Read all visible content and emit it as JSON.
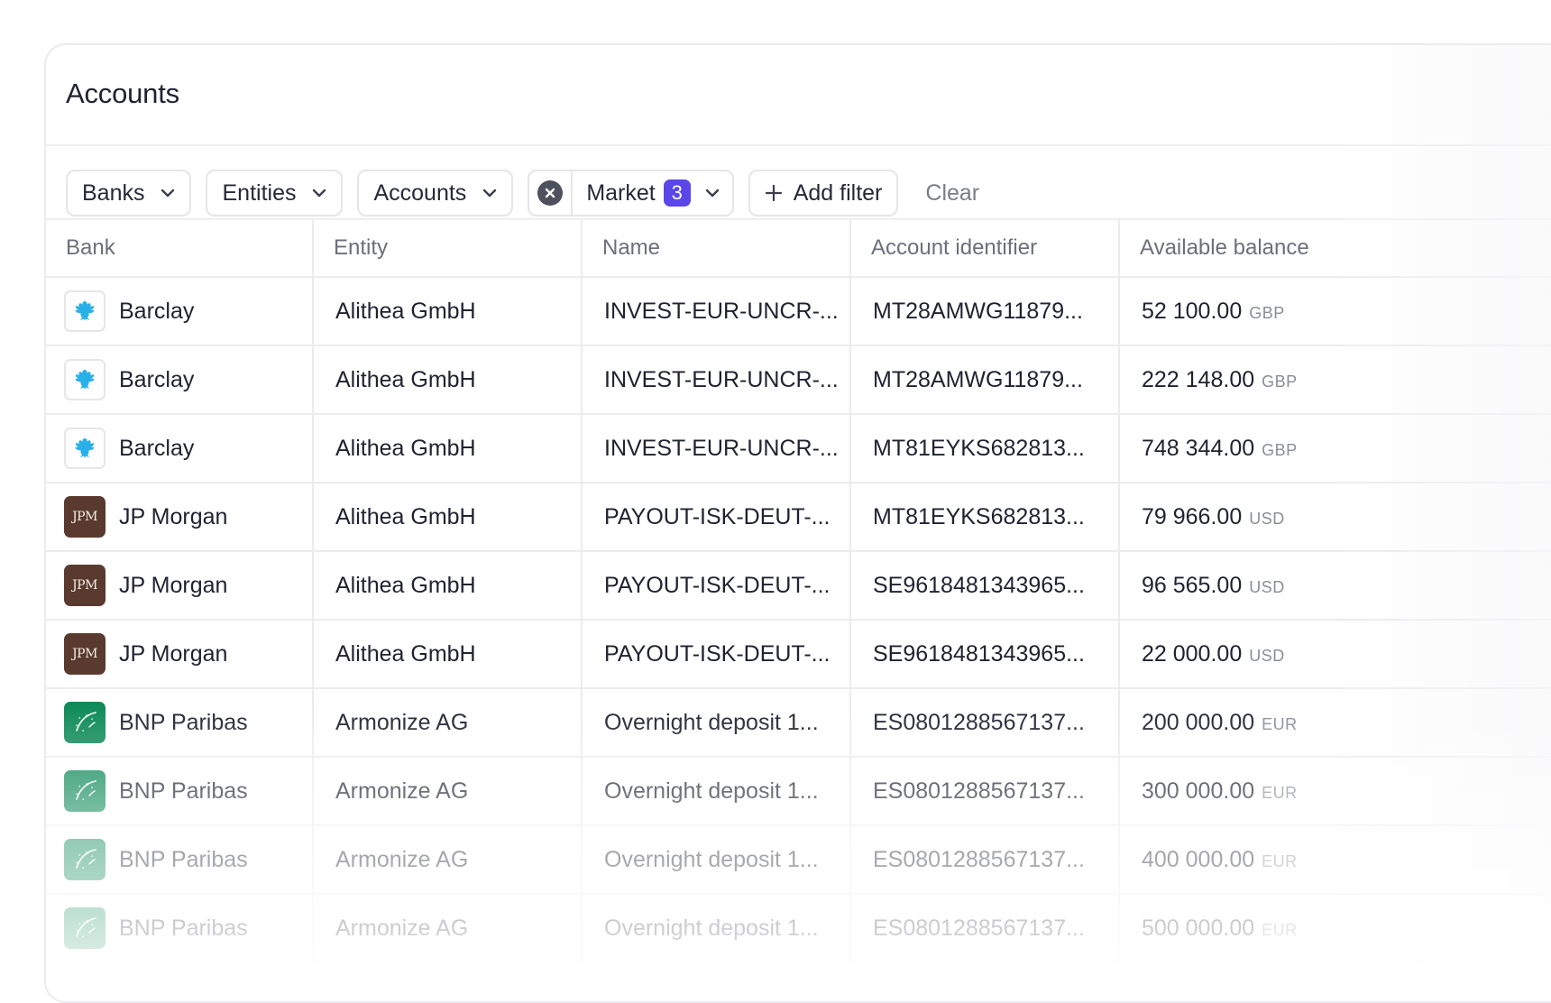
{
  "page": {
    "title": "Accounts"
  },
  "filters": {
    "banks_label": "Banks",
    "entities_label": "Entities",
    "accounts_label": "Accounts",
    "market_label": "Market",
    "market_count": "3",
    "add_filter_label": "Add filter",
    "clear_label": "Clear"
  },
  "table": {
    "columns": [
      "Bank",
      "Entity",
      "Name",
      "Account identifier",
      "Available balance"
    ],
    "rows": [
      {
        "bank": "Barclay",
        "logo": "barclay-eagle-icon",
        "entity": "Alithea GmbH",
        "name": "INVEST-EUR-UNCR-...",
        "account_id": "MT28AMWG11879...",
        "amount": "52 100.00",
        "currency": "GBP"
      },
      {
        "bank": "Barclay",
        "logo": "barclay-eagle-icon",
        "entity": "Alithea GmbH",
        "name": "INVEST-EUR-UNCR-...",
        "account_id": "MT28AMWG11879...",
        "amount": "222 148.00",
        "currency": "GBP"
      },
      {
        "bank": "Barclay",
        "logo": "barclay-eagle-icon",
        "entity": "Alithea GmbH",
        "name": "INVEST-EUR-UNCR-...",
        "account_id": "MT81EYKS682813...",
        "amount": "748 344.00",
        "currency": "GBP"
      },
      {
        "bank": "JP Morgan",
        "logo": "jpm-logo-icon",
        "logo_text": "JPM",
        "entity": "Alithea GmbH",
        "name": "PAYOUT-ISK-DEUT-...",
        "account_id": "MT81EYKS682813...",
        "amount": "79 966.00",
        "currency": "USD"
      },
      {
        "bank": "JP Morgan",
        "logo": "jpm-logo-icon",
        "logo_text": "JPM",
        "entity": "Alithea GmbH",
        "name": "PAYOUT-ISK-DEUT-...",
        "account_id": "SE9618481343965...",
        "amount": "96 565.00",
        "currency": "USD"
      },
      {
        "bank": "JP Morgan",
        "logo": "jpm-logo-icon",
        "logo_text": "JPM",
        "entity": "Alithea GmbH",
        "name": "PAYOUT-ISK-DEUT-...",
        "account_id": "SE9618481343965...",
        "amount": "22 000.00",
        "currency": "USD"
      },
      {
        "bank": "BNP Paribas",
        "logo": "bnp-stars-icon",
        "entity": "Armonize AG",
        "name": "Overnight deposit 1...",
        "account_id": "ES0801288567137...",
        "amount": "200 000.00",
        "currency": "EUR"
      },
      {
        "bank": "BNP Paribas",
        "logo": "bnp-stars-icon",
        "entity": "Armonize AG",
        "name": "Overnight deposit 1...",
        "account_id": "ES0801288567137...",
        "amount": "300 000.00",
        "currency": "EUR"
      },
      {
        "bank": "BNP Paribas",
        "logo": "bnp-stars-icon",
        "entity": "Armonize AG",
        "name": "Overnight deposit 1...",
        "account_id": "ES0801288567137...",
        "amount": "400 000.00",
        "currency": "EUR"
      },
      {
        "bank": "BNP Paribas",
        "logo": "bnp-stars-icon",
        "entity": "Armonize AG",
        "name": "Overnight deposit 1...",
        "account_id": "ES0801288567137...",
        "amount": "500 000.00",
        "currency": "EUR"
      }
    ]
  },
  "colors": {
    "accent": "#5b46e8",
    "barclay_blue": "#2ab0e8",
    "jpm_brown": "#5a3a2e",
    "bnp_green": "#0e8a58"
  }
}
